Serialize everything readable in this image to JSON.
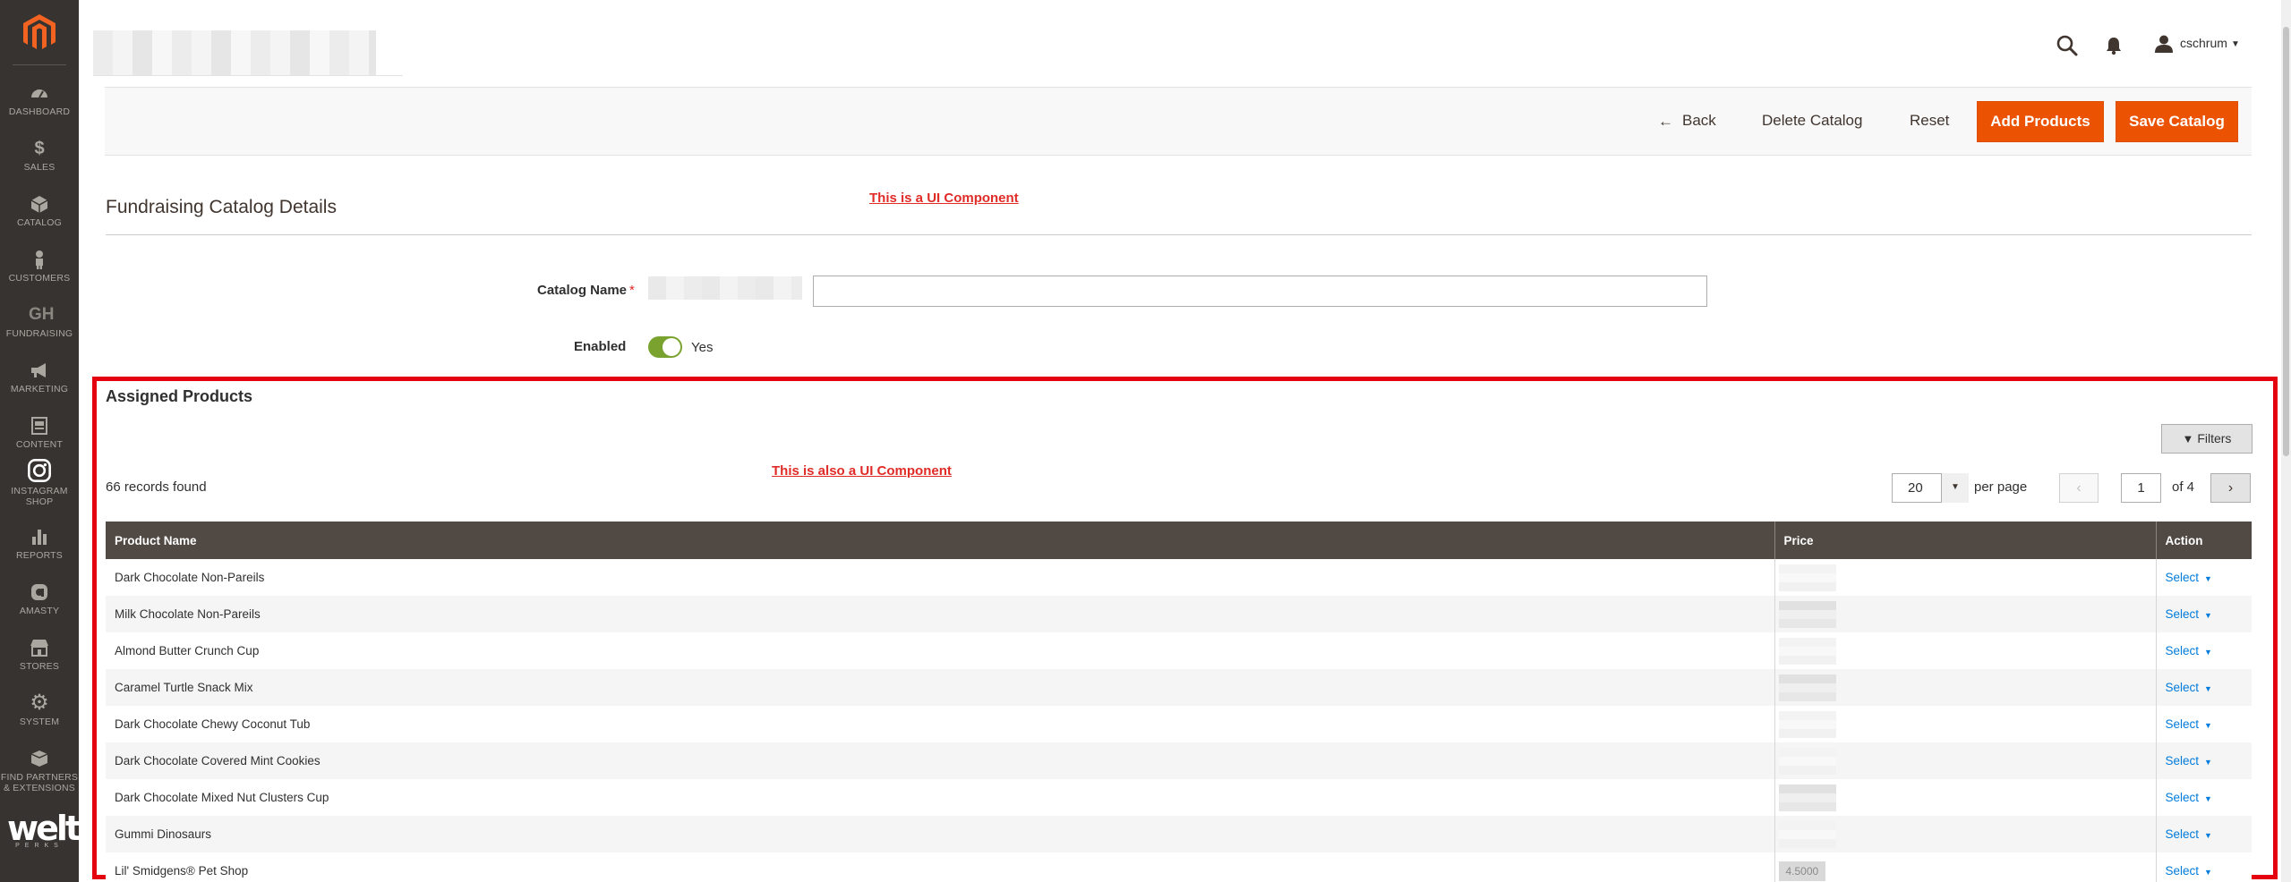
{
  "sidebar": {
    "items": [
      {
        "label": "DASHBOARD",
        "icon": "speedometer-icon"
      },
      {
        "label": "SALES",
        "icon": "dollar-icon"
      },
      {
        "label": "CATALOG",
        "icon": "cube-icon"
      },
      {
        "label": "CUSTOMERS",
        "icon": "person-icon"
      },
      {
        "label": "FUNDRAISING",
        "icon": "gh-icon"
      },
      {
        "label": "MARKETING",
        "icon": "megaphone-icon"
      },
      {
        "label": "CONTENT",
        "icon": "content-icon"
      },
      {
        "label": "INSTAGRAM",
        "label2": "SHOP",
        "icon": "instagram-icon"
      },
      {
        "label": "REPORTS",
        "icon": "bar-chart-icon"
      },
      {
        "label": "AMASTY",
        "icon": "amasty-icon"
      },
      {
        "label": "STORES",
        "icon": "store-icon"
      },
      {
        "label": "SYSTEM",
        "icon": "gear-icon"
      },
      {
        "label": "FIND PARTNERS",
        "label2": "& EXTENSIONS",
        "icon": "box-icon"
      }
    ],
    "gh_text": "GH",
    "brand": {
      "name": "welt",
      "tagline": "PERKS"
    }
  },
  "header": {
    "user_name": "cschrum"
  },
  "actions": {
    "back": "Back",
    "delete": "Delete Catalog",
    "reset": "Reset",
    "add_products": "Add Products",
    "save": "Save Catalog"
  },
  "form": {
    "title": "Fundraising Catalog Details",
    "annotation": "This is a UI Component",
    "catalog_name_label": "Catalog Name",
    "catalog_name_value": "",
    "enabled_label": "Enabled",
    "enabled_value": "Yes"
  },
  "assigned": {
    "title": "Assigned Products",
    "annotation": "This is also a UI Component",
    "filters_label": "Filters",
    "records_found": "66 records found",
    "per_page_value": "20",
    "per_page_label": "per page",
    "page_value": "1",
    "page_of": "of 4",
    "columns": [
      "Product Name",
      "Price",
      "Action"
    ],
    "rows": [
      {
        "name": "Dark Chocolate Non-Pareils",
        "action": "Select"
      },
      {
        "name": "Milk Chocolate Non-Pareils",
        "action": "Select"
      },
      {
        "name": "Almond Butter Crunch Cup",
        "action": "Select"
      },
      {
        "name": "Caramel Turtle Snack Mix",
        "action": "Select"
      },
      {
        "name": "Dark Chocolate Chewy Coconut Tub",
        "action": "Select"
      },
      {
        "name": "Dark Chocolate Covered Mint Cookies",
        "action": "Select"
      },
      {
        "name": "Dark Chocolate Mixed Nut Clusters Cup",
        "action": "Select"
      },
      {
        "name": "Gummi Dinosaurs",
        "action": "Select"
      },
      {
        "name": "Lil' Smidgens® Pet Shop",
        "price": "4.5000",
        "action": "Select"
      }
    ]
  },
  "colors": {
    "sidebar_bg": "#373330",
    "accent_orange": "#eb5202",
    "annotation_red": "#e02b27",
    "frame_red": "#e4000f",
    "grid_header": "#514943",
    "link_blue": "#007bdb",
    "toggle_green": "#79a22e"
  }
}
